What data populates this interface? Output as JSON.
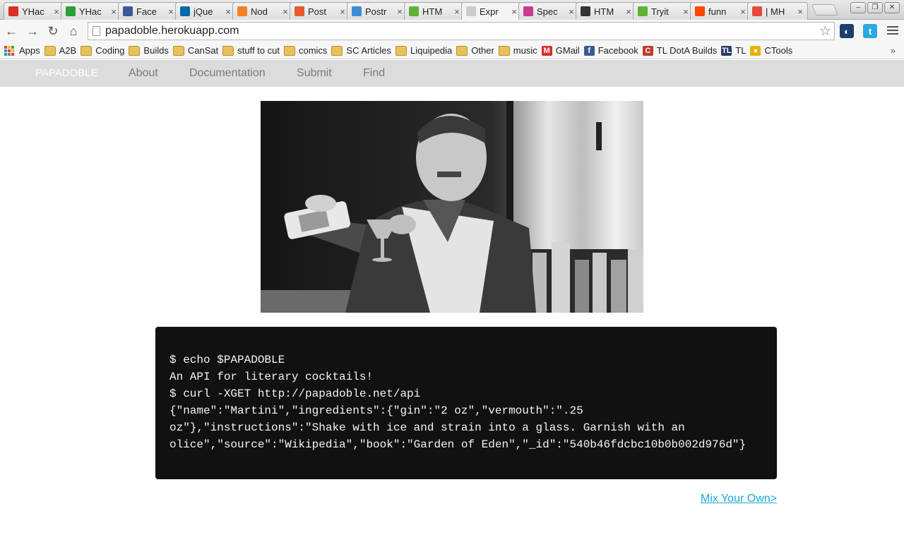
{
  "tabs": [
    {
      "label": "YHac",
      "icon": "gmail-icon",
      "color": "#d93025"
    },
    {
      "label": "YHac",
      "icon": "yhack-icon",
      "color": "#2a9d3a"
    },
    {
      "label": "Face",
      "icon": "facebook-icon",
      "color": "#3b5998"
    },
    {
      "label": "jQue",
      "icon": "jquery-icon",
      "color": "#0769ad"
    },
    {
      "label": "Nod",
      "icon": "stackoverflow-icon",
      "color": "#f48024"
    },
    {
      "label": "Post",
      "icon": "postman-icon",
      "color": "#e85a2b"
    },
    {
      "label": "Postr",
      "icon": "globe-icon",
      "color": "#3c8dd9"
    },
    {
      "label": "HTM",
      "icon": "w3-icon",
      "color": "#5fb236"
    },
    {
      "label": "Expr",
      "icon": "page-icon",
      "color": "#cccccc"
    },
    {
      "label": "Spec",
      "icon": "mdn-icon",
      "color": "#c83b8d"
    },
    {
      "label": "HTM",
      "icon": "html-icon",
      "color": "#333333"
    },
    {
      "label": "Tryit",
      "icon": "w3-icon",
      "color": "#5fb236"
    },
    {
      "label": "funn",
      "icon": "reddit-icon",
      "color": "#ff4500"
    },
    {
      "label": "| MH",
      "icon": "pinwheel-icon",
      "color": "#e8483b"
    }
  ],
  "window_controls": {
    "minimize": "–",
    "restore": "❐",
    "close": "✕"
  },
  "toolbar": {
    "back": "←",
    "forward": "→",
    "reload": "↻",
    "home": "⌂",
    "url": "papadoble.herokuapp.com",
    "star": "☆",
    "ext1": "◐",
    "ext2": "t"
  },
  "bookmarks": [
    {
      "label": "Apps",
      "type": "apps"
    },
    {
      "label": "A2B",
      "type": "folder"
    },
    {
      "label": "Coding",
      "type": "folder"
    },
    {
      "label": "Builds",
      "type": "folder"
    },
    {
      "label": "CanSat",
      "type": "folder"
    },
    {
      "label": "stuff to cut",
      "type": "folder"
    },
    {
      "label": "comics",
      "type": "folder"
    },
    {
      "label": "SC Articles",
      "type": "folder"
    },
    {
      "label": "Liquipedia",
      "type": "folder"
    },
    {
      "label": "Other",
      "type": "folder"
    },
    {
      "label": "music",
      "type": "folder"
    },
    {
      "label": "GMail",
      "type": "site",
      "glyph": "M",
      "color": "#d93025"
    },
    {
      "label": "Facebook",
      "type": "site",
      "glyph": "f",
      "color": "#3b5998"
    },
    {
      "label": "TL DotA Builds",
      "type": "site",
      "glyph": "C",
      "color": "#c0392b"
    },
    {
      "label": "TL",
      "type": "site",
      "glyph": "TL",
      "color": "#2a3b6b"
    },
    {
      "label": "CTools",
      "type": "site",
      "glyph": "●",
      "color": "#e6b400"
    }
  ],
  "bookmarks_overflow": "»",
  "site_nav": {
    "brand": "PAPADOBLE",
    "links": [
      "About",
      "Documentation",
      "Submit",
      "Find"
    ]
  },
  "terminal": {
    "lines": [
      "$ echo $PAPADOBLE",
      "An API for literary cocktails!",
      "$ curl -XGET http://papadoble.net/api",
      "{\"name\":\"Martini\",\"ingredients\":{\"gin\":\"2 oz\",\"vermouth\":\".25",
      "oz\"},\"instructions\":\"Shake with ice and strain into a glass. Garnish with an",
      "olice\",\"source\":\"Wikipedia\",\"book\":\"Garden of Eden\",\"_id\":\"540b46fdcbc10b0b002d976d\"}"
    ]
  },
  "mix_link": "Mix Your Own>"
}
